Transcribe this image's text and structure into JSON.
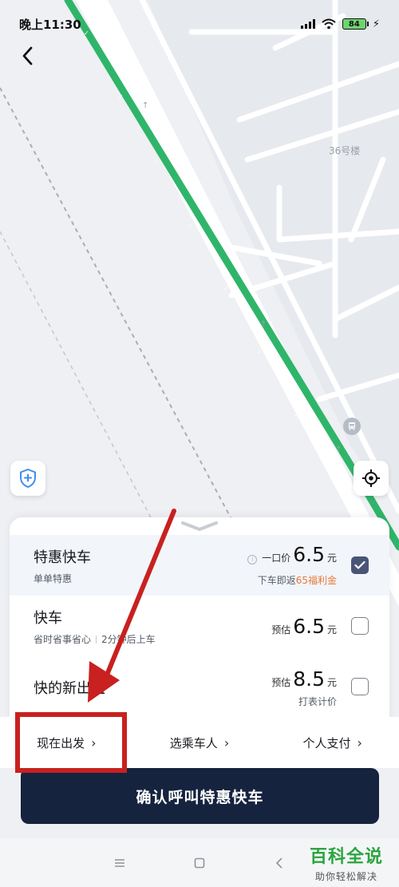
{
  "status_bar": {
    "time": "晚上11:30",
    "battery": "84"
  },
  "map": {
    "building_label": "36号楼",
    "route_color": "#2fb56a"
  },
  "rides": [
    {
      "name": "特惠快车",
      "sub": "单单特惠",
      "price_prefix": "一口价",
      "price": "6.5",
      "unit": "元",
      "note_text": "下车即返",
      "note_highlight": "65福利金",
      "selected": true
    },
    {
      "name": "快车",
      "sub_a": "省时省事省心",
      "sub_b": "2分钟后上车",
      "price_prefix": "预估",
      "price": "6.5",
      "unit": "元",
      "selected": false
    },
    {
      "name": "快的新出租",
      "price_prefix": "预估",
      "price": "8.5",
      "unit": "元",
      "note_text": "打表计价",
      "selected": false
    }
  ],
  "options": {
    "depart_now": "现在出发",
    "choose_rider": "选乘车人",
    "personal_pay": "个人支付"
  },
  "confirm_label": "确认呼叫特惠快车",
  "watermark": {
    "title": "百科全说",
    "subtitle": "助你轻松解决"
  },
  "colors": {
    "accent_dark": "#15233f",
    "annotation": "#c8211f",
    "highlight": "#e8793a"
  }
}
